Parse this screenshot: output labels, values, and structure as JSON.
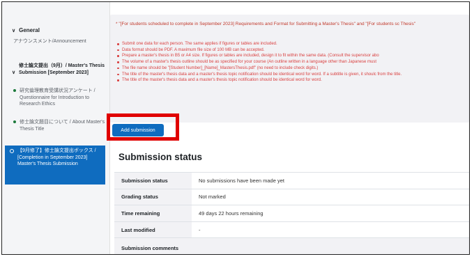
{
  "sidebar": {
    "section_label": "General",
    "items": [
      {
        "label": "アナウンスメント/Announcement"
      },
      {
        "label": "修士論文提出（9月）/ Master's Thesis Submission [September 2023]"
      },
      {
        "label": "研究倫理教育受講状況アンケート / Questionnaire for Introduction to Research Ethics"
      },
      {
        "label": "修士論文題目について / About Master's Thesis Title"
      },
      {
        "label": "【9月修了】修士論文提出ボックス / [Completion in September 2023] Master's Thesis Submission"
      }
    ]
  },
  "info": {
    "title": "* \"[For students scheduled to complete in September 2023] Requirements and Format for Submitting a Master's Thesis\" and \"[For students sc Thesis\"",
    "bullets": [
      "Submit one data for each person. The same applies if figures or tables are included.",
      "Data format should be PDF. A maximum file size of 100 MB can be accepted.",
      "Prepare a master's thesis in B5 or A4 size. If figures or tables are included, design it to fit within the same data. (Consult the supervisor abo",
      "The volume of a master's thesis outline should be as specified for your course (An outline written in a language other than Japanese must",
      "The file name should be \"[Student Number]_[Name]_MastersThesis.pdf\" (no need to include check digits.)",
      "The title of the master's thesis data and a master's thesis topic notification should be identical word for word. If a subtitle is given, it shoulc from the title.",
      "The title of the master's thesis data and a master's thesis topic notification should be identical word for word."
    ]
  },
  "add_submission_label": "Add submission",
  "status": {
    "heading": "Submission status",
    "rows": [
      {
        "label": "Submission status",
        "value": "No submissions have been made yet"
      },
      {
        "label": "Grading status",
        "value": "Not marked"
      },
      {
        "label": "Time remaining",
        "value": "49 days 22 hours remaining"
      },
      {
        "label": "Last modified",
        "value": "-"
      },
      {
        "label": "Submission comments",
        "value": ""
      }
    ]
  }
}
